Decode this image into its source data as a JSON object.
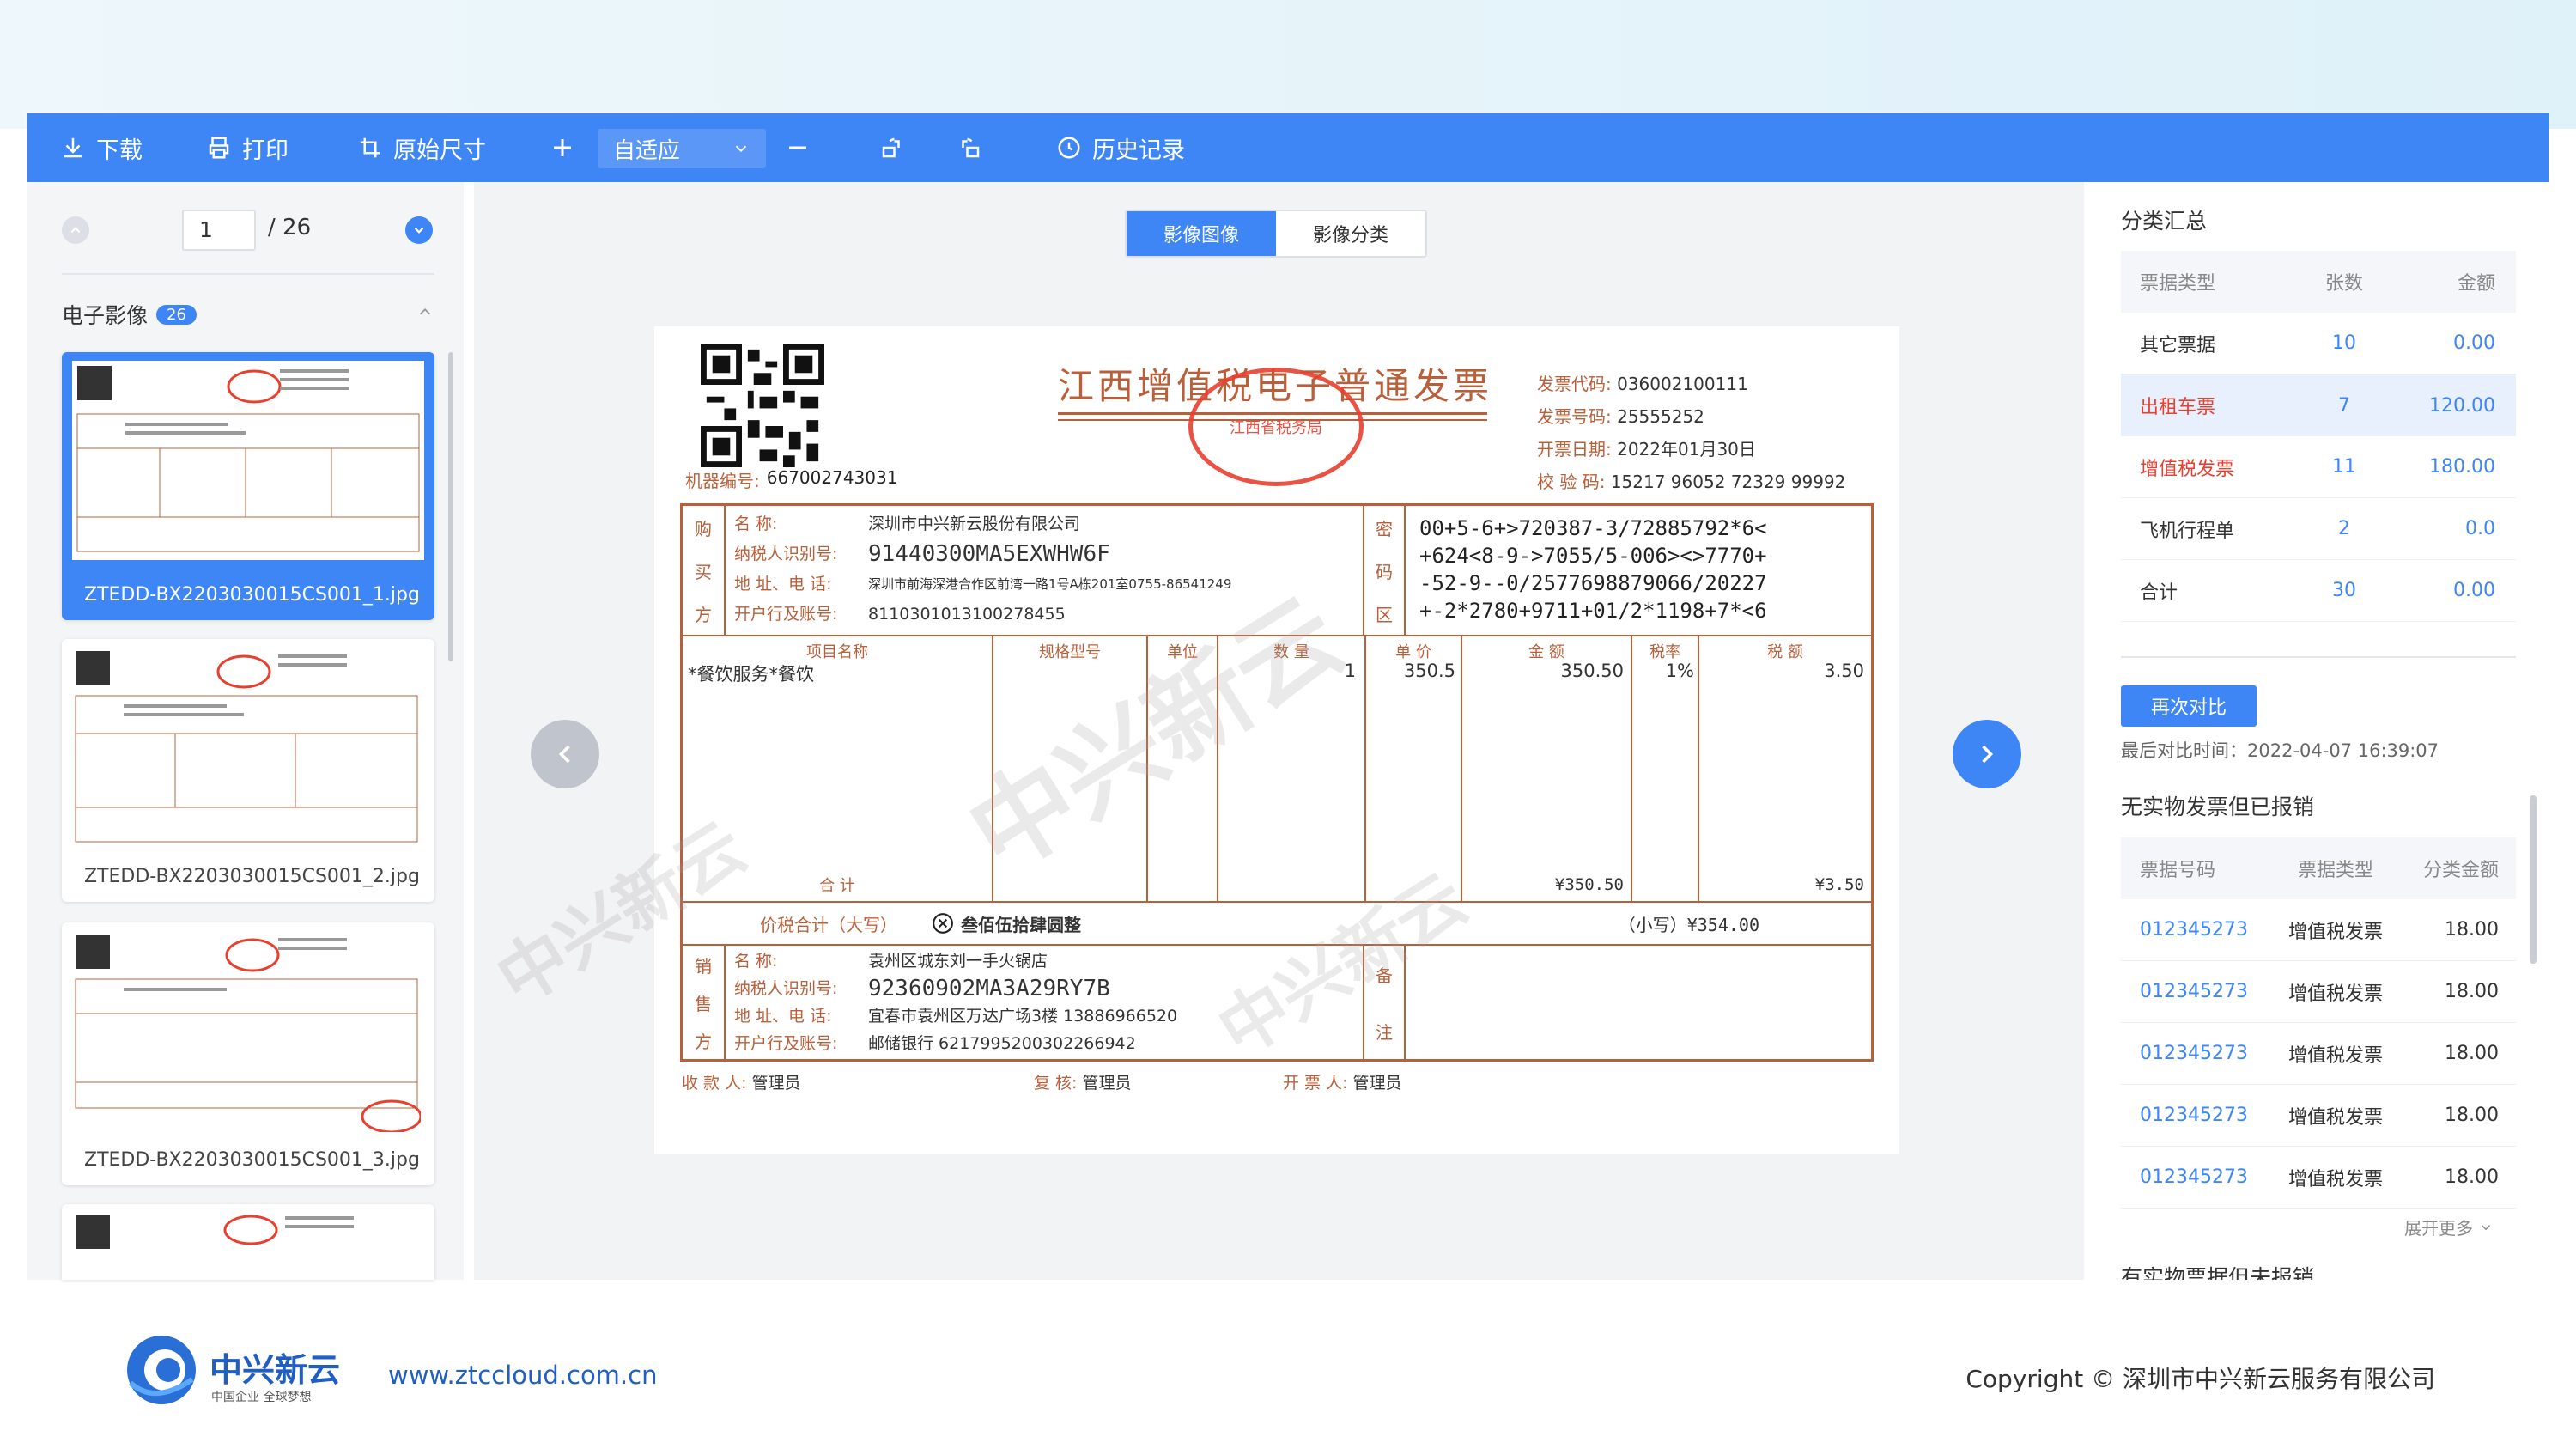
{
  "toolbar": {
    "download": "下载",
    "print": "打印",
    "original_size": "原始尺寸",
    "zoom_value": "自适应",
    "history": "历史记录"
  },
  "pager": {
    "current": "1",
    "total": "/ 26"
  },
  "left": {
    "section_title": "电子影像",
    "count": "26",
    "thumbs": [
      {
        "caption": "ZTEDD-BX2203030015CS001_1.jpg"
      },
      {
        "caption": "ZTEDD-BX2203030015CS001_2.jpg"
      },
      {
        "caption": "ZTEDD-BX2203030015CS001_3.jpg"
      }
    ]
  },
  "view_tabs": [
    "影像图像",
    "影像分类"
  ],
  "invoice": {
    "title": "江西增值税电子普通发票",
    "machine_no_label": "机器编号:",
    "machine_no": "667002743031",
    "code_label": "发票代码:",
    "code": "036002100111",
    "number_label": "发票号码:",
    "number": "25555252",
    "date_label": "开票日期:",
    "date": "2022年01月30日",
    "check_label": "校 验 码:",
    "check": "15217 96052 72329 99992",
    "buyer_side": [
      "购",
      "买",
      "方"
    ],
    "buyer_name_label": "名 称:",
    "buyer_name": "深圳市中兴新云股份有限公司",
    "buyer_tax_label": "纳税人识别号:",
    "buyer_tax": "91440300MA5EXWHW6F",
    "buyer_addr_label": "地 址、电 话:",
    "buyer_addr": "深圳市前海深港合作区前湾一路1号A栋201室0755-86541249",
    "buyer_bank_label": "开户行及账号:",
    "buyer_bank": "8110301013100278455",
    "cipher_side": [
      "密",
      "码",
      "区"
    ],
    "cipher": [
      "00+5-6+>720387-3/72885792*6<",
      "+624<8-9->7055/5-006><>7770+",
      "-52-9--0/2577698879066/20227",
      "+-2*2780+9711+01/2*1198+7*<6"
    ],
    "col_headers": [
      "项目名称",
      "规格型号",
      "单位",
      "数 量",
      "单 价",
      "金 额",
      "税率",
      "税 额"
    ],
    "item_name": "*餐饮服务*餐饮",
    "item_qty": "1",
    "item_price": "350.5",
    "item_amount": "350.50",
    "item_rate": "1%",
    "item_tax": "3.50",
    "total_label": "合 计",
    "total_amount": "¥350.50",
    "total_tax": "¥3.50",
    "grand_label": "价税合计（大写）",
    "grand_words": "叁佰伍拾肆圆整",
    "grand_small": "（小写）¥354.00",
    "seller_side": [
      "销",
      "售",
      "方"
    ],
    "seller_name_label": "名 称:",
    "seller_name": "袁州区城东刘一手火锅店",
    "seller_tax_label": "纳税人识别号:",
    "seller_tax": "92360902MA3A29RY7B",
    "seller_addr_label": "地 址、电 话:",
    "seller_addr": "宜春市袁州区万达广场3楼 13886966520",
    "seller_bank_label": "开户行及账号:",
    "seller_bank": "邮储银行 6217995200302266942",
    "remark_side": [
      "备",
      "注"
    ],
    "payee_label": "收 款 人:",
    "payee": "管理员",
    "reviewer_label": "复 核:",
    "reviewer": "管理员",
    "drawer_label": "开 票 人:",
    "drawer": "管理员",
    "stamp": "江西省税务局"
  },
  "right": {
    "summary_title": "分类汇总",
    "summary_headers": [
      "票据类型",
      "张数",
      "金额"
    ],
    "summary_rows": [
      {
        "type": "其它票据",
        "count": "10",
        "amount": "0.00",
        "red": false
      },
      {
        "type": "出租车票",
        "count": "7",
        "amount": "120.00",
        "red": true
      },
      {
        "type": "增值税发票",
        "count": "11",
        "amount": "180.00",
        "red": true
      },
      {
        "type": "飞机行程单",
        "count": "2",
        "amount": "0.0",
        "red": false
      },
      {
        "type": "合计",
        "count": "30",
        "amount": "0.00",
        "red": false
      }
    ],
    "compare_button": "再次对比",
    "last_compare": "最后对比时间：2022-04-07 16:39:07",
    "section2_title": "无实物发票但已报销",
    "s2_headers": [
      "票据号码",
      "票据类型",
      "分类金额"
    ],
    "s2_rows": [
      {
        "no": "012345273",
        "type": "增值税发票",
        "amount": "18.00"
      },
      {
        "no": "012345273",
        "type": "增值税发票",
        "amount": "18.00"
      },
      {
        "no": "012345273",
        "type": "增值税发票",
        "amount": "18.00"
      },
      {
        "no": "012345273",
        "type": "增值税发票",
        "amount": "18.00"
      },
      {
        "no": "012345273",
        "type": "增值税发票",
        "amount": "18.00"
      }
    ],
    "expand_more": "展开更多",
    "section3_title": "有实物票据但未报销"
  },
  "footer": {
    "brand": "中兴新云",
    "slogan": "中国企业 全球梦想",
    "url": "www.ztccloud.com.cn",
    "copyright": "Copyright © 深圳市中兴新云服务有限公司"
  },
  "colors": {
    "primary": "#3e86f6",
    "red": "#e8402f",
    "invoice": "#b9603a",
    "link": "#3e86f6"
  }
}
